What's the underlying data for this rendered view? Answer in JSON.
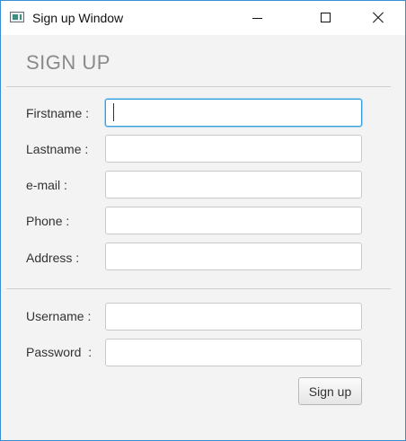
{
  "window": {
    "title": "Sign up Window"
  },
  "heading": "SIGN UP",
  "form": {
    "firstname_label": "Firstname :",
    "lastname_label": "Lastname :",
    "email_label": "e-mail :",
    "phone_label": "Phone :",
    "address_label": "Address :",
    "username_label": "Username :",
    "password_label": "Password  :",
    "firstname_value": "",
    "lastname_value": "",
    "email_value": "",
    "phone_value": "",
    "address_value": "",
    "username_value": "",
    "password_value": ""
  },
  "signup_button": "Sign up"
}
